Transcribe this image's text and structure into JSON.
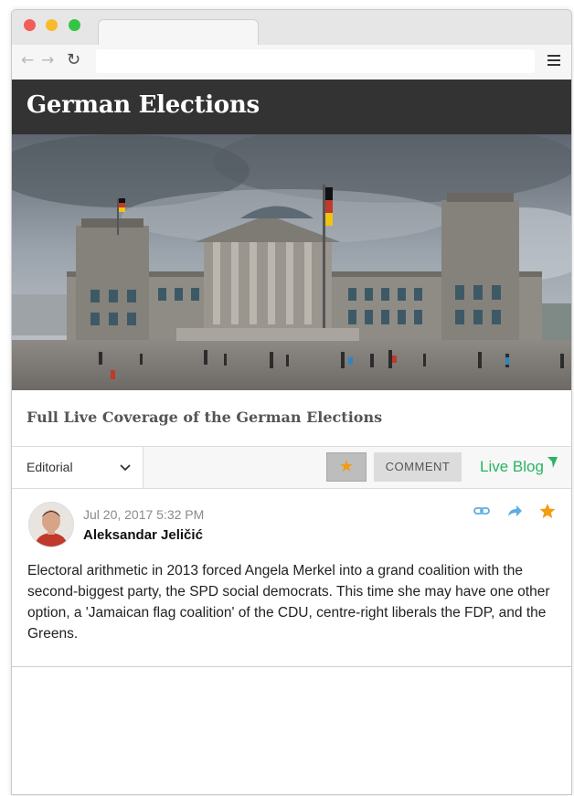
{
  "header": {
    "title": "German Elections"
  },
  "hero": {
    "alt": "Reichstag building in Berlin"
  },
  "subtitle": "Full Live Coverage of the German Elections",
  "controls": {
    "dropdown_value": "Editorial",
    "comment_label": "COMMENT",
    "brand_label": "Live Blog"
  },
  "post": {
    "date": "Jul 20, 2017 5:32 PM",
    "author": "Aleksandar Jeličić",
    "body": "Electoral arithmetic in 2013 forced Angela Merkel into a grand coalition with the second-biggest party, the SPD social democrats. This time she may have one other option, a 'Jamaican flag coalition' of the CDU, centre-right liberals the FDP, and the Greens."
  },
  "icons": {
    "back": "back-arrow-icon",
    "forward": "forward-arrow-icon",
    "reload": "reload-icon",
    "menu": "hamburger-menu-icon",
    "star": "star-icon",
    "chevron": "chevron-down-icon",
    "link": "link-icon",
    "share": "share-icon"
  },
  "colors": {
    "header_bg": "#333333",
    "accent_green": "#28b463",
    "accent_blue": "#5dade2",
    "star_orange": "#f39c12"
  }
}
